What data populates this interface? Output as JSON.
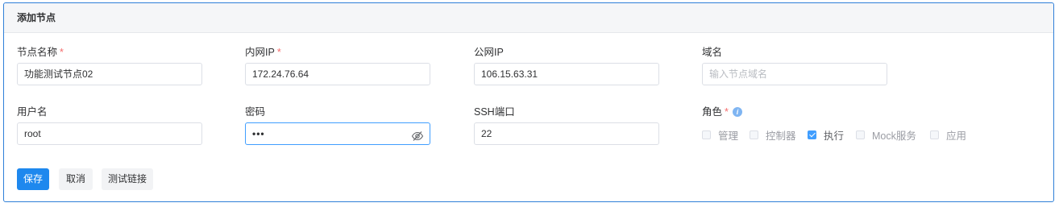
{
  "header": {
    "title": "添加节点"
  },
  "form": {
    "node_name": {
      "label": "节点名称",
      "required": "*",
      "value": "功能测试节点02"
    },
    "internal_ip": {
      "label": "内网IP",
      "required": "*",
      "value": "172.24.76.64"
    },
    "public_ip": {
      "label": "公网IP",
      "value": "106.15.63.31"
    },
    "domain": {
      "label": "域名",
      "placeholder": "输入节点域名"
    },
    "username": {
      "label": "用户名",
      "value": "root"
    },
    "password": {
      "label": "密码",
      "value": "•••"
    },
    "ssh_port": {
      "label": "SSH端口",
      "value": "22"
    },
    "role": {
      "label": "角色",
      "required": "*",
      "info_icon": "info-icon",
      "options": [
        {
          "label": "管理",
          "checked": false
        },
        {
          "label": "控制器",
          "checked": false
        },
        {
          "label": "执行",
          "checked": true
        },
        {
          "label": "Mock服务",
          "checked": false
        },
        {
          "label": "应用",
          "checked": false
        }
      ]
    }
  },
  "actions": {
    "save": "保存",
    "cancel": "取消",
    "test": "测试链接"
  },
  "colors": {
    "primary": "#1e88ee",
    "required": "#f56c6c",
    "focus": "#409eff"
  }
}
